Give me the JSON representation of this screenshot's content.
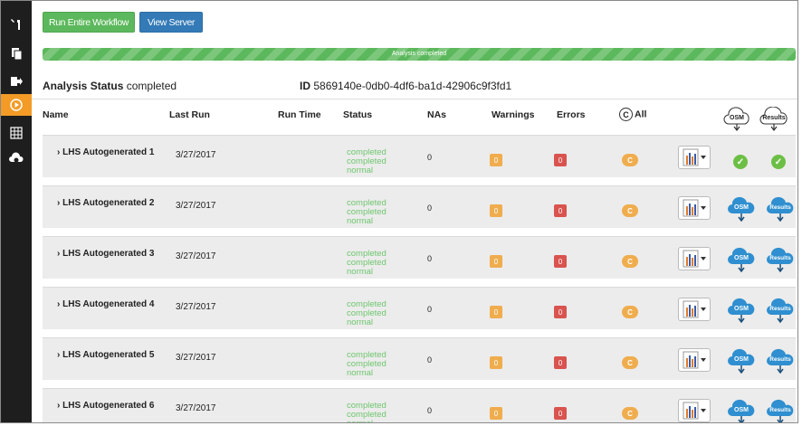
{
  "toolbar": {
    "run_label": "Run Entire Workflow",
    "view_label": "View Server"
  },
  "progress": {
    "label": "Analysis completed",
    "fraction": 1.0
  },
  "analysis": {
    "status_label": "Analysis Status",
    "status_value": "completed",
    "id_label": "ID",
    "id_value": "5869140e-0db0-4df6-ba1d-42906c9f3fd1"
  },
  "table": {
    "headers": {
      "name": "Name",
      "last_run": "Last Run",
      "run_time": "Run Time",
      "status": "Status",
      "nas": "NAs",
      "warnings": "Warnings",
      "errors": "Errors",
      "all": "All",
      "all_icon": "C",
      "osm": "OSM",
      "results": "Results"
    },
    "rows": [
      {
        "name": "LHS Autogenerated 1",
        "date": "3/27/2017",
        "status1": "completed",
        "status2": "completed",
        "status3": "normal",
        "nas": "0",
        "warnings": "0",
        "errors": "0",
        "c": "C",
        "download": "check"
      },
      {
        "name": "LHS Autogenerated 2",
        "date": "3/27/2017",
        "status1": "completed",
        "status2": "completed",
        "status3": "normal",
        "nas": "0",
        "warnings": "0",
        "errors": "0",
        "c": "C",
        "download": "cloud"
      },
      {
        "name": "LHS Autogenerated 3",
        "date": "3/27/2017",
        "status1": "completed",
        "status2": "completed",
        "status3": "normal",
        "nas": "0",
        "warnings": "0",
        "errors": "0",
        "c": "C",
        "download": "cloud"
      },
      {
        "name": "LHS Autogenerated 4",
        "date": "3/27/2017",
        "status1": "completed",
        "status2": "completed",
        "status3": "normal",
        "nas": "0",
        "warnings": "0",
        "errors": "0",
        "c": "C",
        "download": "cloud"
      },
      {
        "name": "LHS Autogenerated 5",
        "date": "3/27/2017",
        "status1": "completed",
        "status2": "completed",
        "status3": "normal",
        "nas": "0",
        "warnings": "0",
        "errors": "0",
        "c": "C",
        "download": "cloud"
      },
      {
        "name": "LHS Autogenerated 6",
        "date": "3/27/2017",
        "status1": "completed",
        "status2": "completed",
        "status3": "normal",
        "nas": "0",
        "warnings": "0",
        "errors": "0",
        "c": "C",
        "download": "cloud"
      }
    ],
    "osm_label": "OSM",
    "results_label": "Results"
  },
  "sidebar": {
    "items": [
      {
        "icon": "tools-icon"
      },
      {
        "icon": "documents-icon"
      },
      {
        "icon": "export-icon"
      },
      {
        "icon": "run-icon",
        "active": true
      },
      {
        "icon": "server-icon"
      },
      {
        "icon": "cloud-sync-icon"
      }
    ]
  },
  "colors": {
    "sidebar_bg": "#1e1e1e",
    "active": "#f39b26",
    "success": "#5cb85c",
    "primary": "#337ab7",
    "warning": "#f0ad4e",
    "danger": "#d9534f",
    "status_text": "#6fc66f",
    "cloud": "#2f8fd0"
  }
}
